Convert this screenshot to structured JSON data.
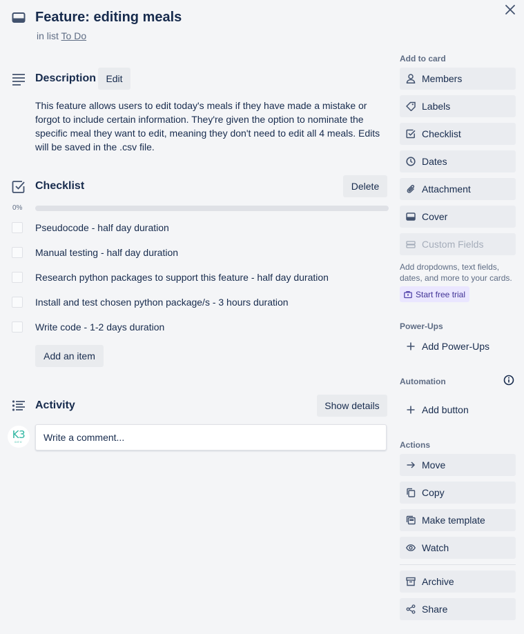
{
  "header": {
    "title": "Feature: editing meals",
    "in_list_prefix": "in list",
    "list_name": "To Do"
  },
  "description": {
    "heading": "Description",
    "edit_label": "Edit",
    "text": "This feature allows users to edit today's meals if they have made a mistake or forgot to include certain information. They're given the option to nominate the specific meal they want to edit, meaning they don't need to edit all 4 meals. Edits will be saved in the .csv file."
  },
  "checklist": {
    "heading": "Checklist",
    "delete_label": "Delete",
    "progress_text": "0%",
    "progress_fraction": 0,
    "items": [
      {
        "label": "Pseudocode - half day duration",
        "checked": false
      },
      {
        "label": "Manual testing - half day duration",
        "checked": false
      },
      {
        "label": "Research python packages to support this feature - half day duration",
        "checked": false
      },
      {
        "label": "Install and test chosen python package/s - 3 hours duration",
        "checked": false
      },
      {
        "label": "Write code - 1-2 days duration",
        "checked": false
      }
    ],
    "add_item_label": "Add an item"
  },
  "activity": {
    "heading": "Activity",
    "show_details_label": "Show details",
    "avatar_text": "K3",
    "avatar_subtext": "DEV",
    "comment_placeholder": "Write a comment..."
  },
  "sidebar": {
    "add_to_card": {
      "heading": "Add to card",
      "members": "Members",
      "labels": "Labels",
      "checklist": "Checklist",
      "dates": "Dates",
      "attachment": "Attachment",
      "cover": "Cover",
      "custom_fields": "Custom Fields",
      "note": "Add dropdowns, text fields, dates, and more to your cards.",
      "trial": "Start free trial"
    },
    "power_ups": {
      "heading": "Power-Ups",
      "add": "Add Power-Ups"
    },
    "automation": {
      "heading": "Automation",
      "add_button": "Add button"
    },
    "actions": {
      "heading": "Actions",
      "move": "Move",
      "copy": "Copy",
      "make_template": "Make template",
      "watch": "Watch",
      "archive": "Archive",
      "share": "Share"
    }
  },
  "colors": {
    "background": "#f4f5f7",
    "button": "#eaecf0",
    "text": "#172b4d",
    "muted": "#5e6c84",
    "trial_bg": "#eae6ff",
    "trial_text": "#403294",
    "avatar_accent": "#2bb5a0"
  }
}
